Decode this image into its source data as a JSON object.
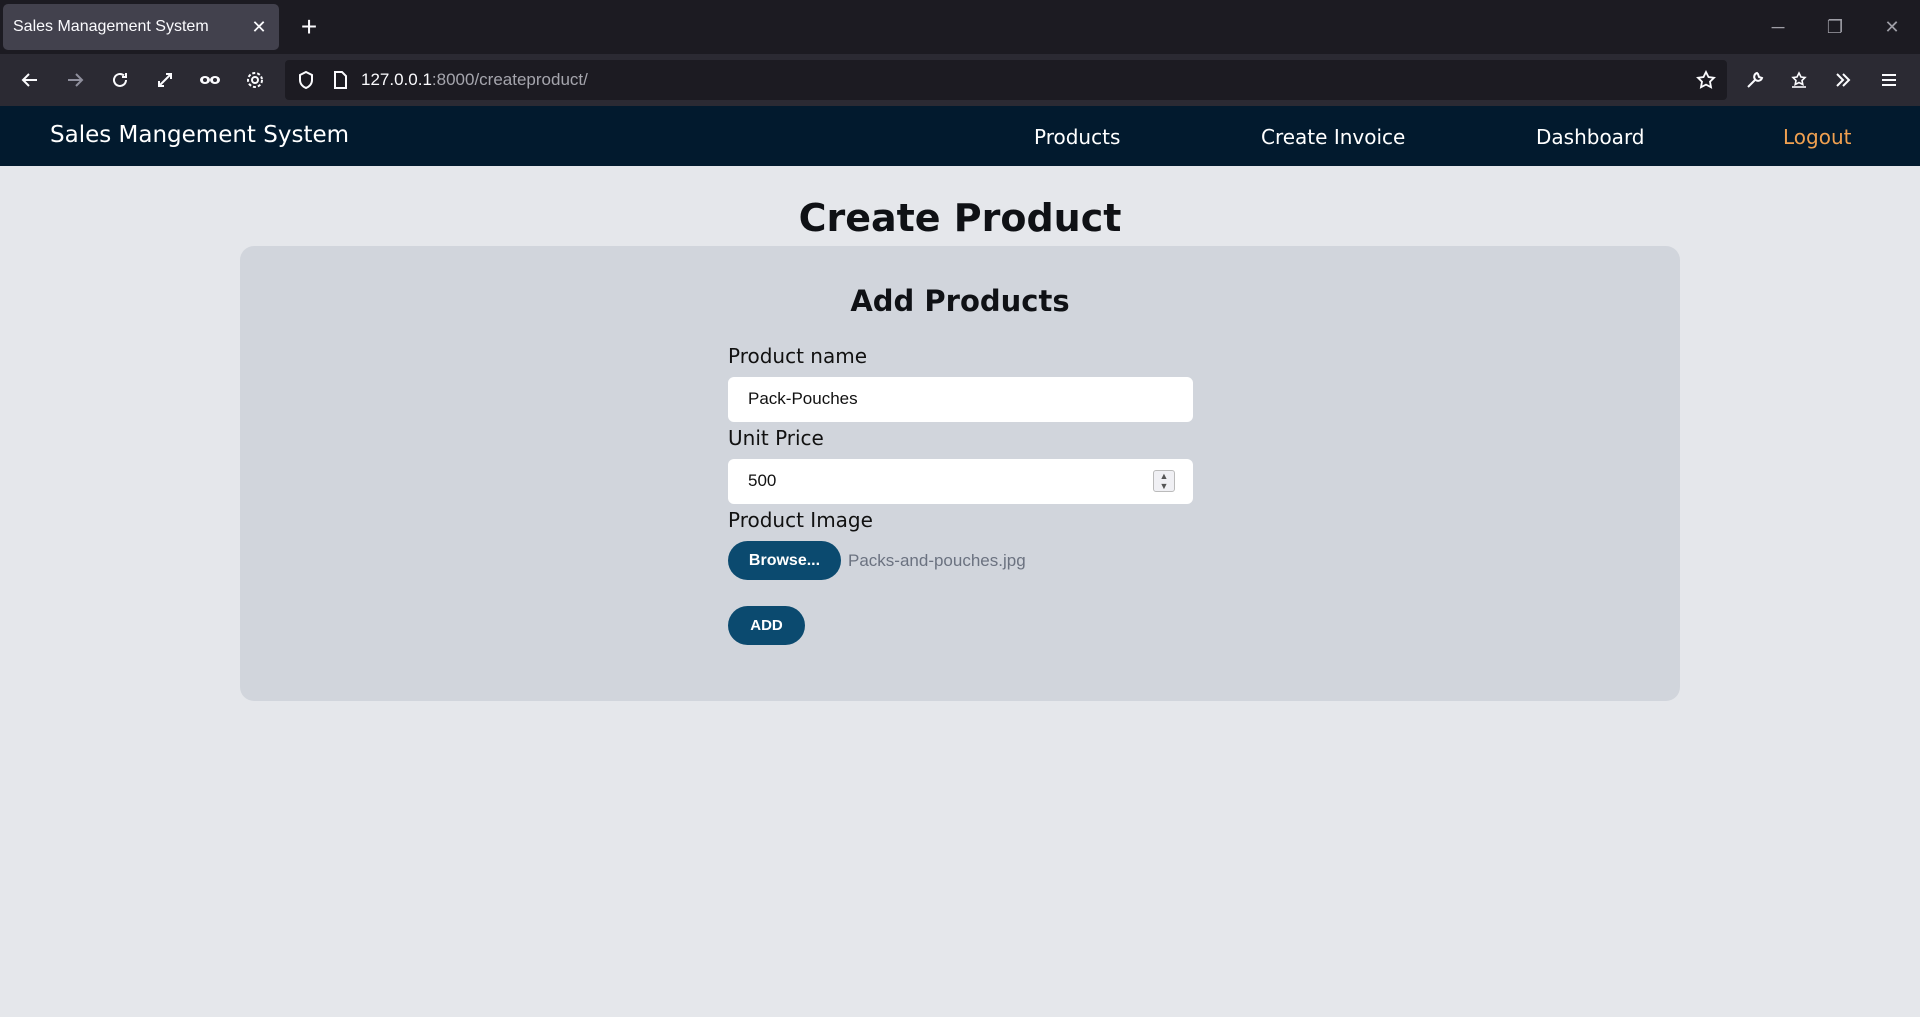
{
  "browser": {
    "tab_title": "Sales Management System",
    "tab_close": "✕",
    "new_tab": "+",
    "url_host": "127.0.0.1",
    "url_path": ":8000/createproduct/"
  },
  "appnav": {
    "brand": "Sales Mangement System",
    "links": {
      "products": "Products",
      "create_invoice": "Create Invoice",
      "dashboard": "Dashboard",
      "logout": "Logout"
    }
  },
  "page": {
    "title": "Create Product",
    "form": {
      "heading": "Add Products",
      "product_name_label": "Product name",
      "product_name_value": "Pack-Pouches",
      "unit_price_label": "Unit Price",
      "unit_price_value": "500",
      "product_image_label": "Product Image",
      "browse_label": "Browse...",
      "file_name": "Packs-and-pouches.jpg",
      "add_label": "ADD"
    }
  },
  "colors": {
    "app_nav_bg": "#021a2e",
    "button_bg": "#0b4a6f",
    "logout": "#f0a050",
    "card_bg": "#d1d5dc",
    "page_bg": "#e5e7eb"
  }
}
